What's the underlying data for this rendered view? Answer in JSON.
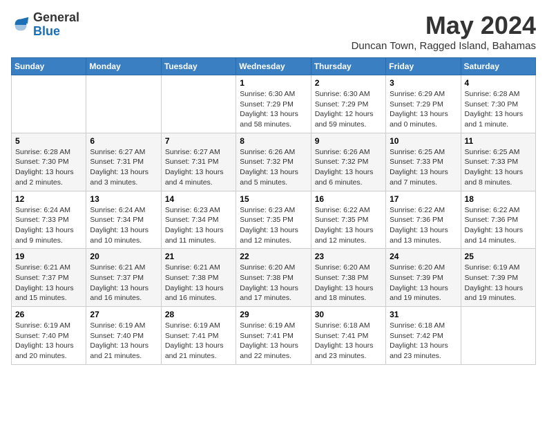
{
  "logo": {
    "general": "General",
    "blue": "Blue"
  },
  "title": "May 2024",
  "location": "Duncan Town, Ragged Island, Bahamas",
  "days_of_week": [
    "Sunday",
    "Monday",
    "Tuesday",
    "Wednesday",
    "Thursday",
    "Friday",
    "Saturday"
  ],
  "weeks": [
    [
      {
        "day": "",
        "info": ""
      },
      {
        "day": "",
        "info": ""
      },
      {
        "day": "",
        "info": ""
      },
      {
        "day": "1",
        "info": "Sunrise: 6:30 AM\nSunset: 7:29 PM\nDaylight: 13 hours\nand 58 minutes."
      },
      {
        "day": "2",
        "info": "Sunrise: 6:30 AM\nSunset: 7:29 PM\nDaylight: 12 hours\nand 59 minutes."
      },
      {
        "day": "3",
        "info": "Sunrise: 6:29 AM\nSunset: 7:29 PM\nDaylight: 13 hours\nand 0 minutes."
      },
      {
        "day": "4",
        "info": "Sunrise: 6:28 AM\nSunset: 7:30 PM\nDaylight: 13 hours\nand 1 minute."
      }
    ],
    [
      {
        "day": "5",
        "info": "Sunrise: 6:28 AM\nSunset: 7:30 PM\nDaylight: 13 hours\nand 2 minutes."
      },
      {
        "day": "6",
        "info": "Sunrise: 6:27 AM\nSunset: 7:31 PM\nDaylight: 13 hours\nand 3 minutes."
      },
      {
        "day": "7",
        "info": "Sunrise: 6:27 AM\nSunset: 7:31 PM\nDaylight: 13 hours\nand 4 minutes."
      },
      {
        "day": "8",
        "info": "Sunrise: 6:26 AM\nSunset: 7:32 PM\nDaylight: 13 hours\nand 5 minutes."
      },
      {
        "day": "9",
        "info": "Sunrise: 6:26 AM\nSunset: 7:32 PM\nDaylight: 13 hours\nand 6 minutes."
      },
      {
        "day": "10",
        "info": "Sunrise: 6:25 AM\nSunset: 7:33 PM\nDaylight: 13 hours\nand 7 minutes."
      },
      {
        "day": "11",
        "info": "Sunrise: 6:25 AM\nSunset: 7:33 PM\nDaylight: 13 hours\nand 8 minutes."
      }
    ],
    [
      {
        "day": "12",
        "info": "Sunrise: 6:24 AM\nSunset: 7:33 PM\nDaylight: 13 hours\nand 9 minutes."
      },
      {
        "day": "13",
        "info": "Sunrise: 6:24 AM\nSunset: 7:34 PM\nDaylight: 13 hours\nand 10 minutes."
      },
      {
        "day": "14",
        "info": "Sunrise: 6:23 AM\nSunset: 7:34 PM\nDaylight: 13 hours\nand 11 minutes."
      },
      {
        "day": "15",
        "info": "Sunrise: 6:23 AM\nSunset: 7:35 PM\nDaylight: 13 hours\nand 12 minutes."
      },
      {
        "day": "16",
        "info": "Sunrise: 6:22 AM\nSunset: 7:35 PM\nDaylight: 13 hours\nand 12 minutes."
      },
      {
        "day": "17",
        "info": "Sunrise: 6:22 AM\nSunset: 7:36 PM\nDaylight: 13 hours\nand 13 minutes."
      },
      {
        "day": "18",
        "info": "Sunrise: 6:22 AM\nSunset: 7:36 PM\nDaylight: 13 hours\nand 14 minutes."
      }
    ],
    [
      {
        "day": "19",
        "info": "Sunrise: 6:21 AM\nSunset: 7:37 PM\nDaylight: 13 hours\nand 15 minutes."
      },
      {
        "day": "20",
        "info": "Sunrise: 6:21 AM\nSunset: 7:37 PM\nDaylight: 13 hours\nand 16 minutes."
      },
      {
        "day": "21",
        "info": "Sunrise: 6:21 AM\nSunset: 7:38 PM\nDaylight: 13 hours\nand 16 minutes."
      },
      {
        "day": "22",
        "info": "Sunrise: 6:20 AM\nSunset: 7:38 PM\nDaylight: 13 hours\nand 17 minutes."
      },
      {
        "day": "23",
        "info": "Sunrise: 6:20 AM\nSunset: 7:38 PM\nDaylight: 13 hours\nand 18 minutes."
      },
      {
        "day": "24",
        "info": "Sunrise: 6:20 AM\nSunset: 7:39 PM\nDaylight: 13 hours\nand 19 minutes."
      },
      {
        "day": "25",
        "info": "Sunrise: 6:19 AM\nSunset: 7:39 PM\nDaylight: 13 hours\nand 19 minutes."
      }
    ],
    [
      {
        "day": "26",
        "info": "Sunrise: 6:19 AM\nSunset: 7:40 PM\nDaylight: 13 hours\nand 20 minutes."
      },
      {
        "day": "27",
        "info": "Sunrise: 6:19 AM\nSunset: 7:40 PM\nDaylight: 13 hours\nand 21 minutes."
      },
      {
        "day": "28",
        "info": "Sunrise: 6:19 AM\nSunset: 7:41 PM\nDaylight: 13 hours\nand 21 minutes."
      },
      {
        "day": "29",
        "info": "Sunrise: 6:19 AM\nSunset: 7:41 PM\nDaylight: 13 hours\nand 22 minutes."
      },
      {
        "day": "30",
        "info": "Sunrise: 6:18 AM\nSunset: 7:41 PM\nDaylight: 13 hours\nand 23 minutes."
      },
      {
        "day": "31",
        "info": "Sunrise: 6:18 AM\nSunset: 7:42 PM\nDaylight: 13 hours\nand 23 minutes."
      },
      {
        "day": "",
        "info": ""
      }
    ]
  ]
}
